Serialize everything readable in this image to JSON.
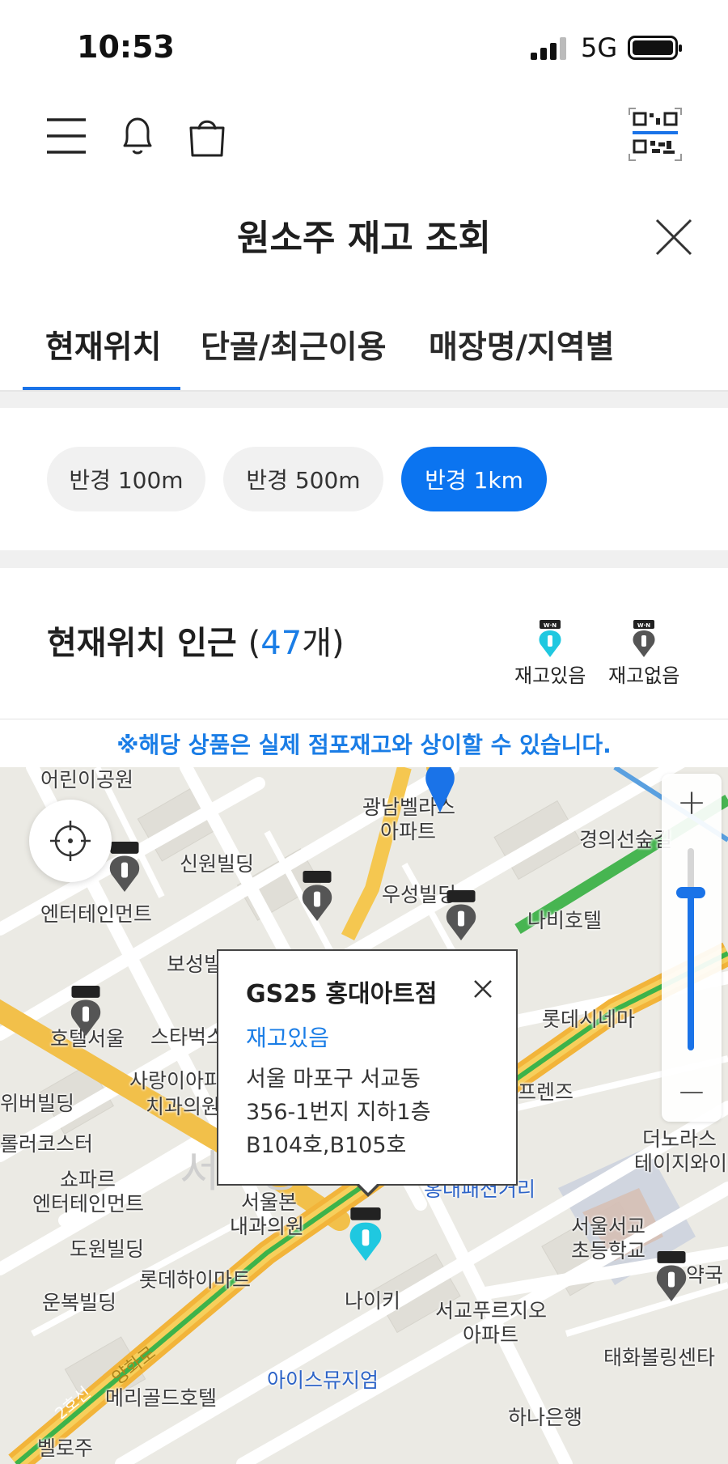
{
  "status_bar": {
    "time": "10:53",
    "network": "5G"
  },
  "header": {
    "title": "원소주 재고 조회"
  },
  "tabs": [
    {
      "label": "현재위치",
      "active": true
    },
    {
      "label": "단골/최근이용",
      "active": false
    },
    {
      "label": "매장명/지역별",
      "active": false
    }
  ],
  "radius_chips": [
    {
      "label": "반경 100m",
      "active": false
    },
    {
      "label": "반경 500m",
      "active": false
    },
    {
      "label": "반경 1km",
      "active": true
    }
  ],
  "nearby": {
    "title": "현재위치 인근",
    "count_open": "(",
    "count": "47",
    "count_suffix": "개)"
  },
  "legend": {
    "in_stock": "재고있음",
    "out_of_stock": "재고없음"
  },
  "notice": "※해당 상품은 실제 점포재고와 상이할 수 있습니다.",
  "map": {
    "zoom_in": "+",
    "zoom_out": "−",
    "labels": [
      "어린이공원",
      "광남벨라스",
      "아파트",
      "신원빌딩",
      "엔터테인먼트",
      "우성빌딩",
      "경의선숲길",
      "나비호텔",
      "보성빌",
      "호텔서울",
      "스타벅스",
      "롯데시네마",
      "위버빌딩",
      "사랑이아파",
      "치과의원",
      "프렌즈",
      "롤러코스터",
      "쇼파르",
      "엔터테인먼트",
      "더노라스",
      "테이지와이",
      "서울본",
      "내과의원",
      "홍대패션거리",
      "서울서교",
      "초등학교",
      "도원빌딩",
      "롯데하이마트",
      "약국",
      "운복빌딩",
      "나이키",
      "서교푸르지오",
      "아파트",
      "태화볼링센타",
      "메리골드호텔",
      "아이스뮤지엄",
      "하나은행",
      "벨로주",
      "2호선",
      "양화로",
      "서교동"
    ],
    "marker_colors": {
      "in_stock": "#1fc8e0",
      "out_of_stock": "#555555",
      "current": "#1a73e8"
    }
  },
  "popup": {
    "store_name": "GS25 홍대아트점",
    "stock_status": "재고있음",
    "address_line1": "서울 마포구 서교동",
    "address_line2": "356-1번지 지하1층",
    "address_line3": "B104호,B105호"
  }
}
